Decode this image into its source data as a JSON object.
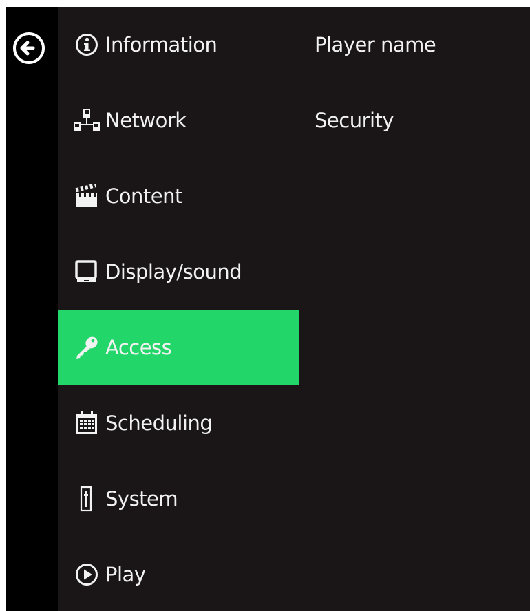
{
  "colors": {
    "background": "#1a1617",
    "rail": "#000000",
    "active": "#22d66a",
    "text": "#f2f2f2"
  },
  "back": {
    "icon": "back-arrow-circle-icon"
  },
  "menu": {
    "active_index": 4,
    "items": [
      {
        "label": "Information",
        "icon": "info-icon"
      },
      {
        "label": "Network",
        "icon": "network-icon"
      },
      {
        "label": "Content",
        "icon": "clapperboard-icon"
      },
      {
        "label": "Display/sound",
        "icon": "monitor-icon"
      },
      {
        "label": "Access",
        "icon": "key-icon"
      },
      {
        "label": "Scheduling",
        "icon": "calendar-icon"
      },
      {
        "label": "System",
        "icon": "system-icon"
      },
      {
        "label": "Play",
        "icon": "play-icon"
      }
    ]
  },
  "submenu": {
    "items": [
      {
        "label": "Player name"
      },
      {
        "label": "Security"
      }
    ]
  }
}
